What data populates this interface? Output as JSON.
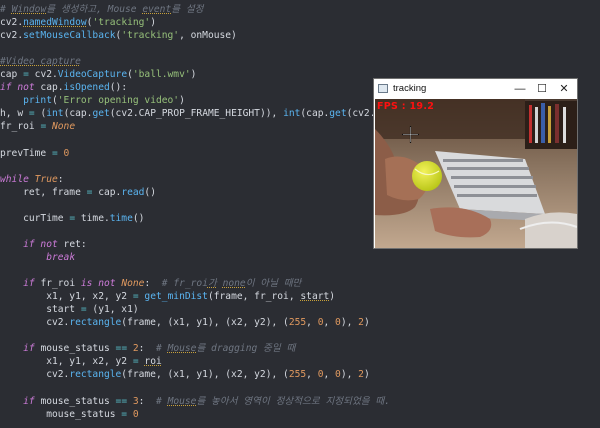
{
  "code_lines": [
    [
      {
        "t": "# ",
        "c": "cmt"
      },
      {
        "t": "Window",
        "c": "cmt u"
      },
      {
        "t": "를 생성하고, Mouse ",
        "c": "cmt"
      },
      {
        "t": "event",
        "c": "cmt u"
      },
      {
        "t": "를 설정",
        "c": "cmt"
      }
    ],
    [
      {
        "t": "cv2.",
        "c": ""
      },
      {
        "t": "namedWindow",
        "c": "fn u"
      },
      {
        "t": "(",
        "c": ""
      },
      {
        "t": "'tracking'",
        "c": "str"
      },
      {
        "t": ")",
        "c": ""
      }
    ],
    [
      {
        "t": "cv2.",
        "c": ""
      },
      {
        "t": "setMouseCallback",
        "c": "fn"
      },
      {
        "t": "(",
        "c": ""
      },
      {
        "t": "'tracking'",
        "c": "str"
      },
      {
        "t": ", onMouse)",
        "c": ""
      }
    ],
    [],
    [
      {
        "t": "#Video capture",
        "c": "cmt u"
      }
    ],
    [
      {
        "t": "cap ",
        "c": ""
      },
      {
        "t": "=",
        "c": "op"
      },
      {
        "t": " cv2.",
        "c": ""
      },
      {
        "t": "VideoCapture",
        "c": "fn"
      },
      {
        "t": "(",
        "c": ""
      },
      {
        "t": "'ball.wmv'",
        "c": "str"
      },
      {
        "t": ")",
        "c": ""
      }
    ],
    [
      {
        "t": "if not",
        "c": "kw"
      },
      {
        "t": " cap.",
        "c": ""
      },
      {
        "t": "isOpened",
        "c": "fn"
      },
      {
        "t": "():",
        "c": ""
      }
    ],
    [
      {
        "t": "    ",
        "c": ""
      },
      {
        "t": "print",
        "c": "fn"
      },
      {
        "t": "(",
        "c": ""
      },
      {
        "t": "'Error opening video'",
        "c": "str"
      },
      {
        "t": ")",
        "c": ""
      }
    ],
    [
      {
        "t": "h, w ",
        "c": ""
      },
      {
        "t": "=",
        "c": "op"
      },
      {
        "t": " (",
        "c": ""
      },
      {
        "t": "int",
        "c": "fn"
      },
      {
        "t": "(cap.",
        "c": ""
      },
      {
        "t": "get",
        "c": "fn"
      },
      {
        "t": "(cv2.CAP_PROP_FRAME_HEIGHT)), ",
        "c": ""
      },
      {
        "t": "int",
        "c": "fn"
      },
      {
        "t": "(cap.",
        "c": ""
      },
      {
        "t": "get",
        "c": "fn"
      },
      {
        "t": "(cv2.CAP_PROP_",
        "c": ""
      }
    ],
    [
      {
        "t": "fr_roi ",
        "c": ""
      },
      {
        "t": "=",
        "c": "op"
      },
      {
        "t": " ",
        "c": ""
      },
      {
        "t": "None",
        "c": "none"
      }
    ],
    [],
    [
      {
        "t": "prevTime ",
        "c": ""
      },
      {
        "t": "=",
        "c": "op"
      },
      {
        "t": " ",
        "c": ""
      },
      {
        "t": "0",
        "c": "num"
      }
    ],
    [],
    [
      {
        "t": "while",
        "c": "kw"
      },
      {
        "t": " ",
        "c": ""
      },
      {
        "t": "True",
        "c": "none"
      },
      {
        "t": ":",
        "c": ""
      }
    ],
    [
      {
        "t": "    ret, frame ",
        "c": ""
      },
      {
        "t": "=",
        "c": "op"
      },
      {
        "t": " cap.",
        "c": ""
      },
      {
        "t": "read",
        "c": "fn"
      },
      {
        "t": "()",
        "c": ""
      }
    ],
    [],
    [
      {
        "t": "    curTime ",
        "c": ""
      },
      {
        "t": "=",
        "c": "op"
      },
      {
        "t": " time.",
        "c": ""
      },
      {
        "t": "time",
        "c": "fn"
      },
      {
        "t": "()",
        "c": ""
      }
    ],
    [],
    [
      {
        "t": "    ",
        "c": ""
      },
      {
        "t": "if not",
        "c": "kw"
      },
      {
        "t": " ret:",
        "c": ""
      }
    ],
    [
      {
        "t": "        ",
        "c": ""
      },
      {
        "t": "break",
        "c": "kw"
      }
    ],
    [],
    [
      {
        "t": "    ",
        "c": ""
      },
      {
        "t": "if",
        "c": "kw"
      },
      {
        "t": " fr_roi ",
        "c": ""
      },
      {
        "t": "is not",
        "c": "kw"
      },
      {
        "t": " ",
        "c": ""
      },
      {
        "t": "None",
        "c": "none"
      },
      {
        "t": ":  ",
        "c": ""
      },
      {
        "t": "# fr_roi",
        "c": "cmt"
      },
      {
        "t": "가",
        "c": "cmt u"
      },
      {
        "t": " ",
        "c": "cmt"
      },
      {
        "t": "none",
        "c": "cmt u"
      },
      {
        "t": "이 아닐 때만",
        "c": "cmt"
      }
    ],
    [
      {
        "t": "        x1, y1, x2, y2 ",
        "c": ""
      },
      {
        "t": "=",
        "c": "op"
      },
      {
        "t": " ",
        "c": ""
      },
      {
        "t": "get_minDist",
        "c": "fn"
      },
      {
        "t": "(frame, fr_roi, ",
        "c": ""
      },
      {
        "t": "start",
        "c": "u"
      },
      {
        "t": ")",
        "c": ""
      }
    ],
    [
      {
        "t": "        start ",
        "c": ""
      },
      {
        "t": "=",
        "c": "op"
      },
      {
        "t": " (y1, x1)",
        "c": ""
      }
    ],
    [
      {
        "t": "        cv2.",
        "c": ""
      },
      {
        "t": "rectangle",
        "c": "fn"
      },
      {
        "t": "(frame, (x1, y1), (x2, y2), (",
        "c": ""
      },
      {
        "t": "255",
        "c": "num"
      },
      {
        "t": ", ",
        "c": ""
      },
      {
        "t": "0",
        "c": "num"
      },
      {
        "t": ", ",
        "c": ""
      },
      {
        "t": "0",
        "c": "num"
      },
      {
        "t": "), ",
        "c": ""
      },
      {
        "t": "2",
        "c": "num"
      },
      {
        "t": ")",
        "c": ""
      }
    ],
    [],
    [
      {
        "t": "    ",
        "c": ""
      },
      {
        "t": "if",
        "c": "kw"
      },
      {
        "t": " mouse_status ",
        "c": ""
      },
      {
        "t": "==",
        "c": "op"
      },
      {
        "t": " ",
        "c": ""
      },
      {
        "t": "2",
        "c": "num"
      },
      {
        "t": ":  ",
        "c": ""
      },
      {
        "t": "# ",
        "c": "cmt"
      },
      {
        "t": "Mouse",
        "c": "cmt u"
      },
      {
        "t": "를 dragging 중일 때",
        "c": "cmt"
      }
    ],
    [
      {
        "t": "        x1, y1, x2, y2 ",
        "c": ""
      },
      {
        "t": "=",
        "c": "op"
      },
      {
        "t": " ",
        "c": ""
      },
      {
        "t": "roi",
        "c": "u"
      }
    ],
    [
      {
        "t": "        cv2.",
        "c": ""
      },
      {
        "t": "rectangle",
        "c": "fn"
      },
      {
        "t": "(frame, (x1, y1), (x2, y2), (",
        "c": ""
      },
      {
        "t": "255",
        "c": "num"
      },
      {
        "t": ", ",
        "c": ""
      },
      {
        "t": "0",
        "c": "num"
      },
      {
        "t": ", ",
        "c": ""
      },
      {
        "t": "0",
        "c": "num"
      },
      {
        "t": "), ",
        "c": ""
      },
      {
        "t": "2",
        "c": "num"
      },
      {
        "t": ")",
        "c": ""
      }
    ],
    [],
    [
      {
        "t": "    ",
        "c": ""
      },
      {
        "t": "if",
        "c": "kw"
      },
      {
        "t": " mouse_status ",
        "c": ""
      },
      {
        "t": "==",
        "c": "op"
      },
      {
        "t": " ",
        "c": ""
      },
      {
        "t": "3",
        "c": "num"
      },
      {
        "t": ":  ",
        "c": ""
      },
      {
        "t": "# ",
        "c": "cmt"
      },
      {
        "t": "Mouse",
        "c": "cmt u"
      },
      {
        "t": "를 놓아서 영역이 정상적으로 지정되었을 때.",
        "c": "cmt"
      }
    ],
    [
      {
        "t": "        mouse_status ",
        "c": ""
      },
      {
        "t": "=",
        "c": "op"
      },
      {
        "t": " ",
        "c": ""
      },
      {
        "t": "0",
        "c": "num"
      }
    ]
  ],
  "window": {
    "title": "tracking",
    "minimize_glyph": "—",
    "maximize_glyph": "☐",
    "close_glyph": "✕",
    "fps_text": "FPS : 19.2"
  },
  "colors": {
    "editor_bg": "#2b2d33",
    "fps_red": "#ff1010",
    "ball": "#d4e020"
  }
}
